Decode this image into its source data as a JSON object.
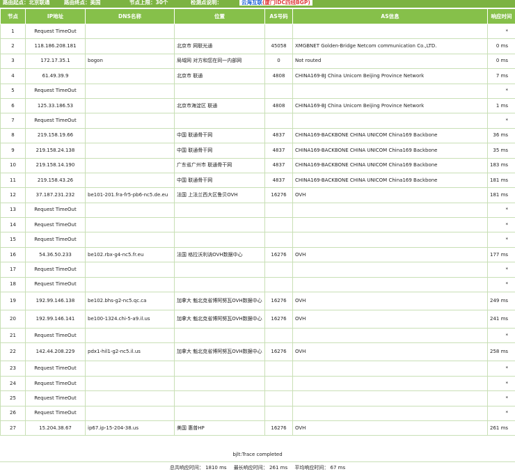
{
  "topbar": {
    "origin": "路由起点：北京联通",
    "destination": "路由终点：美国",
    "node_limit": "节点上限：30个",
    "monitor_label": "检测点说明：",
    "monitor_value": "云海互联",
    "monitor_link": "(厦门IDC四线BGP)"
  },
  "columns": [
    "节点",
    "IP地址",
    "DNS名称",
    "位置",
    "AS号码",
    "AS信息",
    "响应时间"
  ],
  "rows": [
    {
      "n": "1",
      "ip": "Request TimeOut",
      "dns": "",
      "loc": "",
      "asn": "",
      "asinfo": "",
      "rt": "*"
    },
    {
      "n": "2",
      "ip": "118.186.208.181",
      "dns": "",
      "loc": "北京市 网联光通",
      "asn": "45058",
      "asinfo": "XMGBNET Golden-Bridge Netcom communication Co.,LTD.",
      "rt": "0 ms"
    },
    {
      "n": "3",
      "ip": "172.17.35.1",
      "dns": "bogon",
      "loc": "局域网 对方和您在同一内部网",
      "asn": "0",
      "asinfo": "Not routed",
      "rt": "0 ms"
    },
    {
      "n": "4",
      "ip": "61.49.39.9",
      "dns": "",
      "loc": "北京市 联通",
      "asn": "4808",
      "asinfo": "CHINA169-BJ China Unicom Beijing Province Network",
      "rt": "7 ms"
    },
    {
      "n": "5",
      "ip": "Request TimeOut",
      "dns": "",
      "loc": "",
      "asn": "",
      "asinfo": "",
      "rt": "*"
    },
    {
      "n": "6",
      "ip": "125.33.186.53",
      "dns": "",
      "loc": "北京市海淀区 联通",
      "asn": "4808",
      "asinfo": "CHINA169-BJ China Unicom Beijing Province Network",
      "rt": "1 ms"
    },
    {
      "n": "7",
      "ip": "Request TimeOut",
      "dns": "",
      "loc": "",
      "asn": "",
      "asinfo": "",
      "rt": "*"
    },
    {
      "n": "8",
      "ip": "219.158.19.66",
      "dns": "",
      "loc": "中国 联通骨干网",
      "asn": "4837",
      "asinfo": "CHINA169-BACKBONE CHINA UNICOM China169 Backbone",
      "rt": "36 ms"
    },
    {
      "n": "9",
      "ip": "219.158.24.138",
      "dns": "",
      "loc": "中国 联通骨干网",
      "asn": "4837",
      "asinfo": "CHINA169-BACKBONE CHINA UNICOM China169 Backbone",
      "rt": "35 ms"
    },
    {
      "n": "10",
      "ip": "219.158.14.190",
      "dns": "",
      "loc": "广东省广州市 联通骨干网",
      "asn": "4837",
      "asinfo": "CHINA169-BACKBONE CHINA UNICOM China169 Backbone",
      "rt": "183 ms"
    },
    {
      "n": "11",
      "ip": "219.158.43.26",
      "dns": "",
      "loc": "中国 联通骨干网",
      "asn": "4837",
      "asinfo": "CHINA169-BACKBONE CHINA UNICOM China169 Backbone",
      "rt": "181 ms"
    },
    {
      "n": "12",
      "ip": "37.187.231.232",
      "dns": "be101-201.fra-fr5-pb6-nc5.de.eu",
      "loc": "法国 上法兰西大区鲁贝OVH",
      "asn": "16276",
      "asinfo": "OVH",
      "rt": "181 ms"
    },
    {
      "n": "13",
      "ip": "Request TimeOut",
      "dns": "",
      "loc": "",
      "asn": "",
      "asinfo": "",
      "rt": "*"
    },
    {
      "n": "14",
      "ip": "Request TimeOut",
      "dns": "",
      "loc": "",
      "asn": "",
      "asinfo": "",
      "rt": "*"
    },
    {
      "n": "15",
      "ip": "Request TimeOut",
      "dns": "",
      "loc": "",
      "asn": "",
      "asinfo": "",
      "rt": "*"
    },
    {
      "n": "16",
      "ip": "54.36.50.233",
      "dns": "be102.rbx-g4-nc5.fr.eu",
      "loc": "法国 格拉沃利讷OVH数据中心",
      "asn": "16276",
      "asinfo": "OVH",
      "rt": "177 ms"
    },
    {
      "n": "17",
      "ip": "Request TimeOut",
      "dns": "",
      "loc": "",
      "asn": "",
      "asinfo": "",
      "rt": "*"
    },
    {
      "n": "18",
      "ip": "Request TimeOut",
      "dns": "",
      "loc": "",
      "asn": "",
      "asinfo": "",
      "rt": "*"
    },
    {
      "n": "19",
      "ip": "192.99.146.138",
      "dns": "be102.bhs-g2-nc5.qc.ca",
      "loc": "加拿大 魁北克省博阿努瓦OVH数据中心",
      "asn": "16276",
      "asinfo": "OVH",
      "rt": "249 ms"
    },
    {
      "n": "20",
      "ip": "192.99.146.141",
      "dns": "be100-1324.chi-5-a9.il.us",
      "loc": "加拿大 魁北克省博阿努瓦OVH数据中心",
      "asn": "16276",
      "asinfo": "OVH",
      "rt": "241 ms"
    },
    {
      "n": "21",
      "ip": "Request TimeOut",
      "dns": "",
      "loc": "",
      "asn": "",
      "asinfo": "",
      "rt": "*"
    },
    {
      "n": "22",
      "ip": "142.44.208.229",
      "dns": "pdx1-hil1-g2-nc5.il.us",
      "loc": "加拿大 魁北克省博阿努瓦OVH数据中心",
      "asn": "16276",
      "asinfo": "OVH",
      "rt": "258 ms"
    },
    {
      "n": "23",
      "ip": "Request TimeOut",
      "dns": "",
      "loc": "",
      "asn": "",
      "asinfo": "",
      "rt": "*"
    },
    {
      "n": "24",
      "ip": "Request TimeOut",
      "dns": "",
      "loc": "",
      "asn": "",
      "asinfo": "",
      "rt": "*"
    },
    {
      "n": "25",
      "ip": "Request TimeOut",
      "dns": "",
      "loc": "",
      "asn": "",
      "asinfo": "",
      "rt": "*"
    },
    {
      "n": "26",
      "ip": "Request TimeOut",
      "dns": "",
      "loc": "",
      "asn": "",
      "asinfo": "",
      "rt": "*"
    },
    {
      "n": "27",
      "ip": "15.204.38.67",
      "dns": "ip67.ip-15-204-38.us",
      "loc": "美国 惠普HP",
      "asn": "16276",
      "asinfo": "OVH",
      "rt": "261 ms"
    }
  ],
  "footer": {
    "status": "bjlt:Trace completed",
    "total": "总共响应时间：  1810 ms",
    "max": "最长响应时间：  261 ms",
    "avg": "平均响应时间：  67 ms"
  },
  "colors": {
    "header_green": "#86c04a",
    "border": "#c8dfb5",
    "link_blue": "#1a5fd6"
  }
}
